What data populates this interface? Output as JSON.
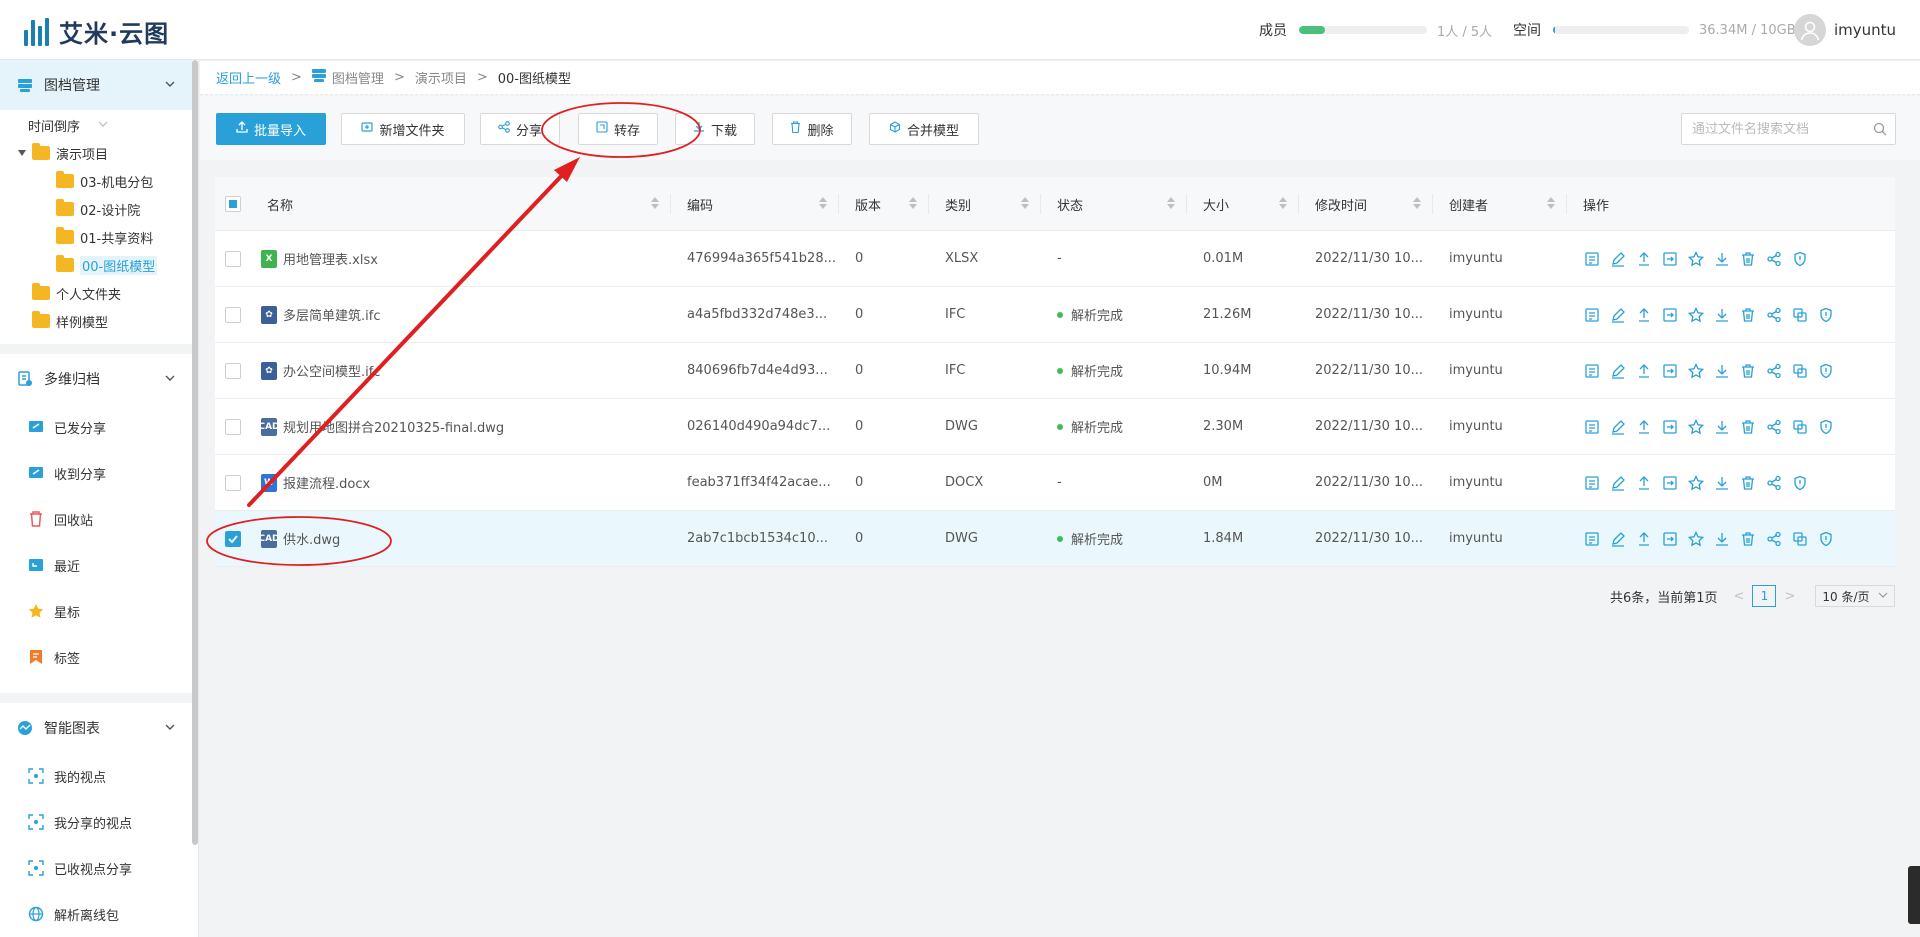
{
  "app": {
    "logo_text": "艾米·云图"
  },
  "header": {
    "members_label": "成员",
    "members_value": "1人 / 5人",
    "members_fraction": 0.2,
    "members_color": "#4cc07a",
    "space_label": "空间",
    "space_value": "36.34M / 10GB",
    "space_fraction": 0.004,
    "space_color": "#29a0d8",
    "username": "imyuntu"
  },
  "sidebar": {
    "section_archive": "图档管理",
    "sort_label": "时间倒序",
    "tree": {
      "root": "演示项目",
      "children": [
        "03-机电分包",
        "02-设计院",
        "01-共享资料",
        "00-图纸模型"
      ],
      "personal": "个人文件夹",
      "samples": "样例模型"
    },
    "section_multi": "多维归档",
    "multi_items": [
      "已发分享",
      "收到分享",
      "回收站",
      "最近",
      "星标",
      "标签"
    ],
    "section_smart": "智能图表",
    "smart_items": [
      "我的视点",
      "我分享的视点",
      "已收视点分享",
      "解析离线包"
    ]
  },
  "breadcrumb": {
    "back": "返回上一级",
    "sep": ">",
    "level1": "图档管理",
    "level2": "演示项目",
    "current": "00-图纸模型"
  },
  "toolbar": {
    "import": "批量导入",
    "new_folder": "新增文件夹",
    "share": "分享",
    "transfer": "转存",
    "download": "下载",
    "delete": "删除",
    "merge": "合并模型",
    "search_placeholder": "通过文件名搜索文档"
  },
  "table": {
    "headers": {
      "name": "名称",
      "code": "编码",
      "version": "版本",
      "type": "类别",
      "status": "状态",
      "size": "大小",
      "modified": "修改时间",
      "creator": "创建者",
      "actions": "操作"
    },
    "rows": [
      {
        "name": "用地管理表.xlsx",
        "icon": "xlsx",
        "code": "476994a365f541b28...",
        "version": "0",
        "type": "XLSX",
        "status": "-",
        "parsed": false,
        "size": "0.01M",
        "modified": "2022/11/30 10...",
        "creator": "imyuntu",
        "checked": false
      },
      {
        "name": "多层简单建筑.ifc",
        "icon": "ifc",
        "code": "a4a5fbd332d748e3...",
        "version": "0",
        "type": "IFC",
        "status": "解析完成",
        "parsed": true,
        "size": "21.26M",
        "modified": "2022/11/30 10...",
        "creator": "imyuntu",
        "checked": false
      },
      {
        "name": "办公空间模型.ifc",
        "icon": "ifc",
        "code": "840696fb7d4e4d93...",
        "version": "0",
        "type": "IFC",
        "status": "解析完成",
        "parsed": true,
        "size": "10.94M",
        "modified": "2022/11/30 10...",
        "creator": "imyuntu",
        "checked": false
      },
      {
        "name": "规划用地图拼合20210325-final.dwg",
        "icon": "dwg",
        "code": "026140d490a94dc7...",
        "version": "0",
        "type": "DWG",
        "status": "解析完成",
        "parsed": true,
        "size": "2.30M",
        "modified": "2022/11/30 10...",
        "creator": "imyuntu",
        "checked": false
      },
      {
        "name": "报建流程.docx",
        "icon": "docx",
        "code": "feab371ff34f42acae...",
        "version": "0",
        "type": "DOCX",
        "status": "-",
        "parsed": false,
        "size": "0M",
        "modified": "2022/11/30 10...",
        "creator": "imyuntu",
        "checked": false
      },
      {
        "name": "供水.dwg",
        "icon": "dwg",
        "code": "2ab7c1bcb1534c10...",
        "version": "0",
        "type": "DWG",
        "status": "解析完成",
        "parsed": true,
        "size": "1.84M",
        "modified": "2022/11/30 10...",
        "creator": "imyuntu",
        "checked": true
      }
    ]
  },
  "pagination": {
    "summary": "共6条，当前第1页",
    "prev": "<",
    "current_page": "1",
    "next": ">",
    "page_size": "10 条/页"
  },
  "accent_color": "#29a0d8",
  "annotation_color": "#e02020"
}
